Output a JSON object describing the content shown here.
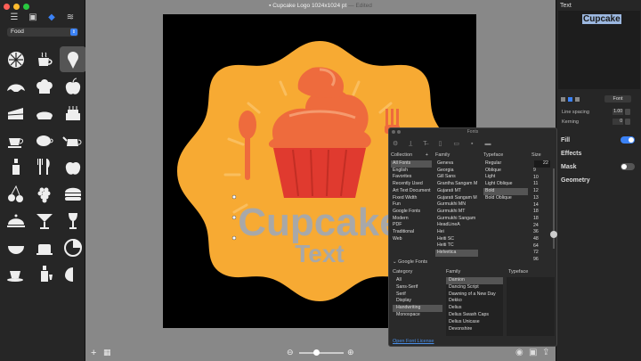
{
  "window": {
    "title": "Cupcake Logo 1024x1024 pt",
    "edited": "— Edited"
  },
  "sidebar": {
    "category": "Food",
    "icons": [
      "orange-slice",
      "coffee-cup",
      "ice-cream",
      "croissant",
      "chef-hat",
      "apple",
      "cake-slice",
      "pie",
      "birthday-cake",
      "tea-cup",
      "coffee-mug",
      "teapot",
      "bottle",
      "fork-knife",
      "apple-2",
      "cherries",
      "grapes",
      "hamburger",
      "serving-cloche",
      "cocktail",
      "wine-glass",
      "bowl",
      "kettle",
      "pizza",
      "cup-saucer",
      "wine-bottle",
      "lemon"
    ]
  },
  "artboard": {
    "text_main": "Cupcake",
    "text_sub": "Text",
    "colors": {
      "badge": "#f7aa33",
      "frosting": "#ee6b3d",
      "cup": "#e03a2f",
      "text": "#a8a8a8"
    }
  },
  "inspector": {
    "section": "Text",
    "preview_text": "Cupcake",
    "font_button": "Font",
    "line_spacing_label": "Line spacing",
    "line_spacing_value": "1.00",
    "kerning_label": "Kerning",
    "kerning_value": "0",
    "fill_label": "Fill",
    "fill_on": true,
    "effects_label": "Effects",
    "mask_label": "Mask",
    "mask_on": false,
    "geometry_label": "Geometry"
  },
  "fonts_panel": {
    "title": "Fonts",
    "collection_header": "Collection",
    "family_header": "Family",
    "typeface_header": "Typeface",
    "size_header": "Size",
    "collections": [
      "All Fonts",
      "English",
      "Favorites",
      "Recently Used",
      "Art Text Document",
      "Fixed Width",
      "Fun",
      "Google Fonts",
      "Modern",
      "PDF",
      "Traditional",
      "Web"
    ],
    "families": [
      "Geneva",
      "Georgia",
      "Gill Sans",
      "Grantha Sangam M",
      "Gujarati MT",
      "Gujarati Sangam M",
      "Gurmukhi MN",
      "Gurmukhi MT",
      "Gurmukhi Sangam",
      "HeadLineA",
      "Hei",
      "Heiti SC",
      "Heiti TC",
      "Helvetica"
    ],
    "typefaces": [
      "Regular",
      "Oblique",
      "Light",
      "Light Oblique",
      "Bold",
      "Bold Oblique"
    ],
    "sizes": [
      "9",
      "10",
      "11",
      "12",
      "13",
      "14",
      "18",
      "18",
      "24",
      "36",
      "48",
      "64",
      "72",
      "96"
    ],
    "size_value": "22",
    "google_fonts_label": "Google Fonts",
    "gf_category_header": "Category",
    "gf_family_header": "Family",
    "gf_typeface_header": "Typeface",
    "gf_categories": [
      "All",
      "Sans-Serif",
      "Serif",
      "Display",
      "Handwriting",
      "Monospace"
    ],
    "gf_families": [
      "Damion",
      "Dancing Script",
      "Dawning of a New Day",
      "Dekko",
      "Delius",
      "Delius Swash Caps",
      "Delius Unicase",
      "Devonshire"
    ],
    "open_license": "Open Font License"
  }
}
